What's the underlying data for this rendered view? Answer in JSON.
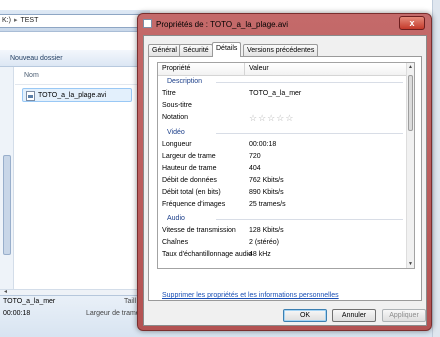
{
  "explorer": {
    "address_prefix": "K:)",
    "address_folder": "TEST",
    "toolbar_new_folder": "Nouveau dossier",
    "column_name": "Nom",
    "file_name": "TOTO_a_la_plage.avi",
    "status_name": "TOTO_a_la_mer",
    "status_duration": "00:00:18",
    "status_label_size": "Taill",
    "status_label_width": "Largeur de trame"
  },
  "dialog": {
    "title": "Propriétés de : TOTO_a_la_plage.avi",
    "close_label": "x",
    "tabs": [
      {
        "label": "Général"
      },
      {
        "label": "Sécurité"
      },
      {
        "label": "Détails"
      },
      {
        "label": "Versions précédentes"
      }
    ],
    "active_tab": "Détails",
    "grid_header": {
      "property": "Propriété",
      "value": "Valeur"
    },
    "sections": {
      "description": "Description",
      "video": "Vidéo",
      "audio": "Audio"
    },
    "description_rows": [
      {
        "key": "Titre",
        "value": "TOTO_a_la_mer"
      },
      {
        "key": "Sous-titre",
        "value": ""
      },
      {
        "key": "Notation",
        "value": ""
      }
    ],
    "rating_stars": 0,
    "video_rows": [
      {
        "key": "Longueur",
        "value": "00:00:18"
      },
      {
        "key": "Largeur de trame",
        "value": "720"
      },
      {
        "key": "Hauteur de trame",
        "value": "404"
      },
      {
        "key": "Débit de données",
        "value": "762 Kbits/s"
      },
      {
        "key": "Débit total (en bits)",
        "value": "890 Kbits/s"
      },
      {
        "key": "Fréquence d'images",
        "value": "25 trames/s"
      }
    ],
    "audio_rows": [
      {
        "key": "Vitesse de transmission",
        "value": "128 Kbits/s"
      },
      {
        "key": "Chaînes",
        "value": "2 (stéréo)"
      },
      {
        "key": "Taux d'échantillonnage audio",
        "value": "48 kHz"
      }
    ],
    "remove_link": "Supprimer les propriétés et les informations personnelles",
    "buttons": {
      "ok": "OK",
      "cancel": "Annuler",
      "apply": "Appliquer"
    }
  },
  "colors": {
    "accent": "#b35252",
    "link": "#1a4fb5",
    "section": "#1c3f8a"
  }
}
